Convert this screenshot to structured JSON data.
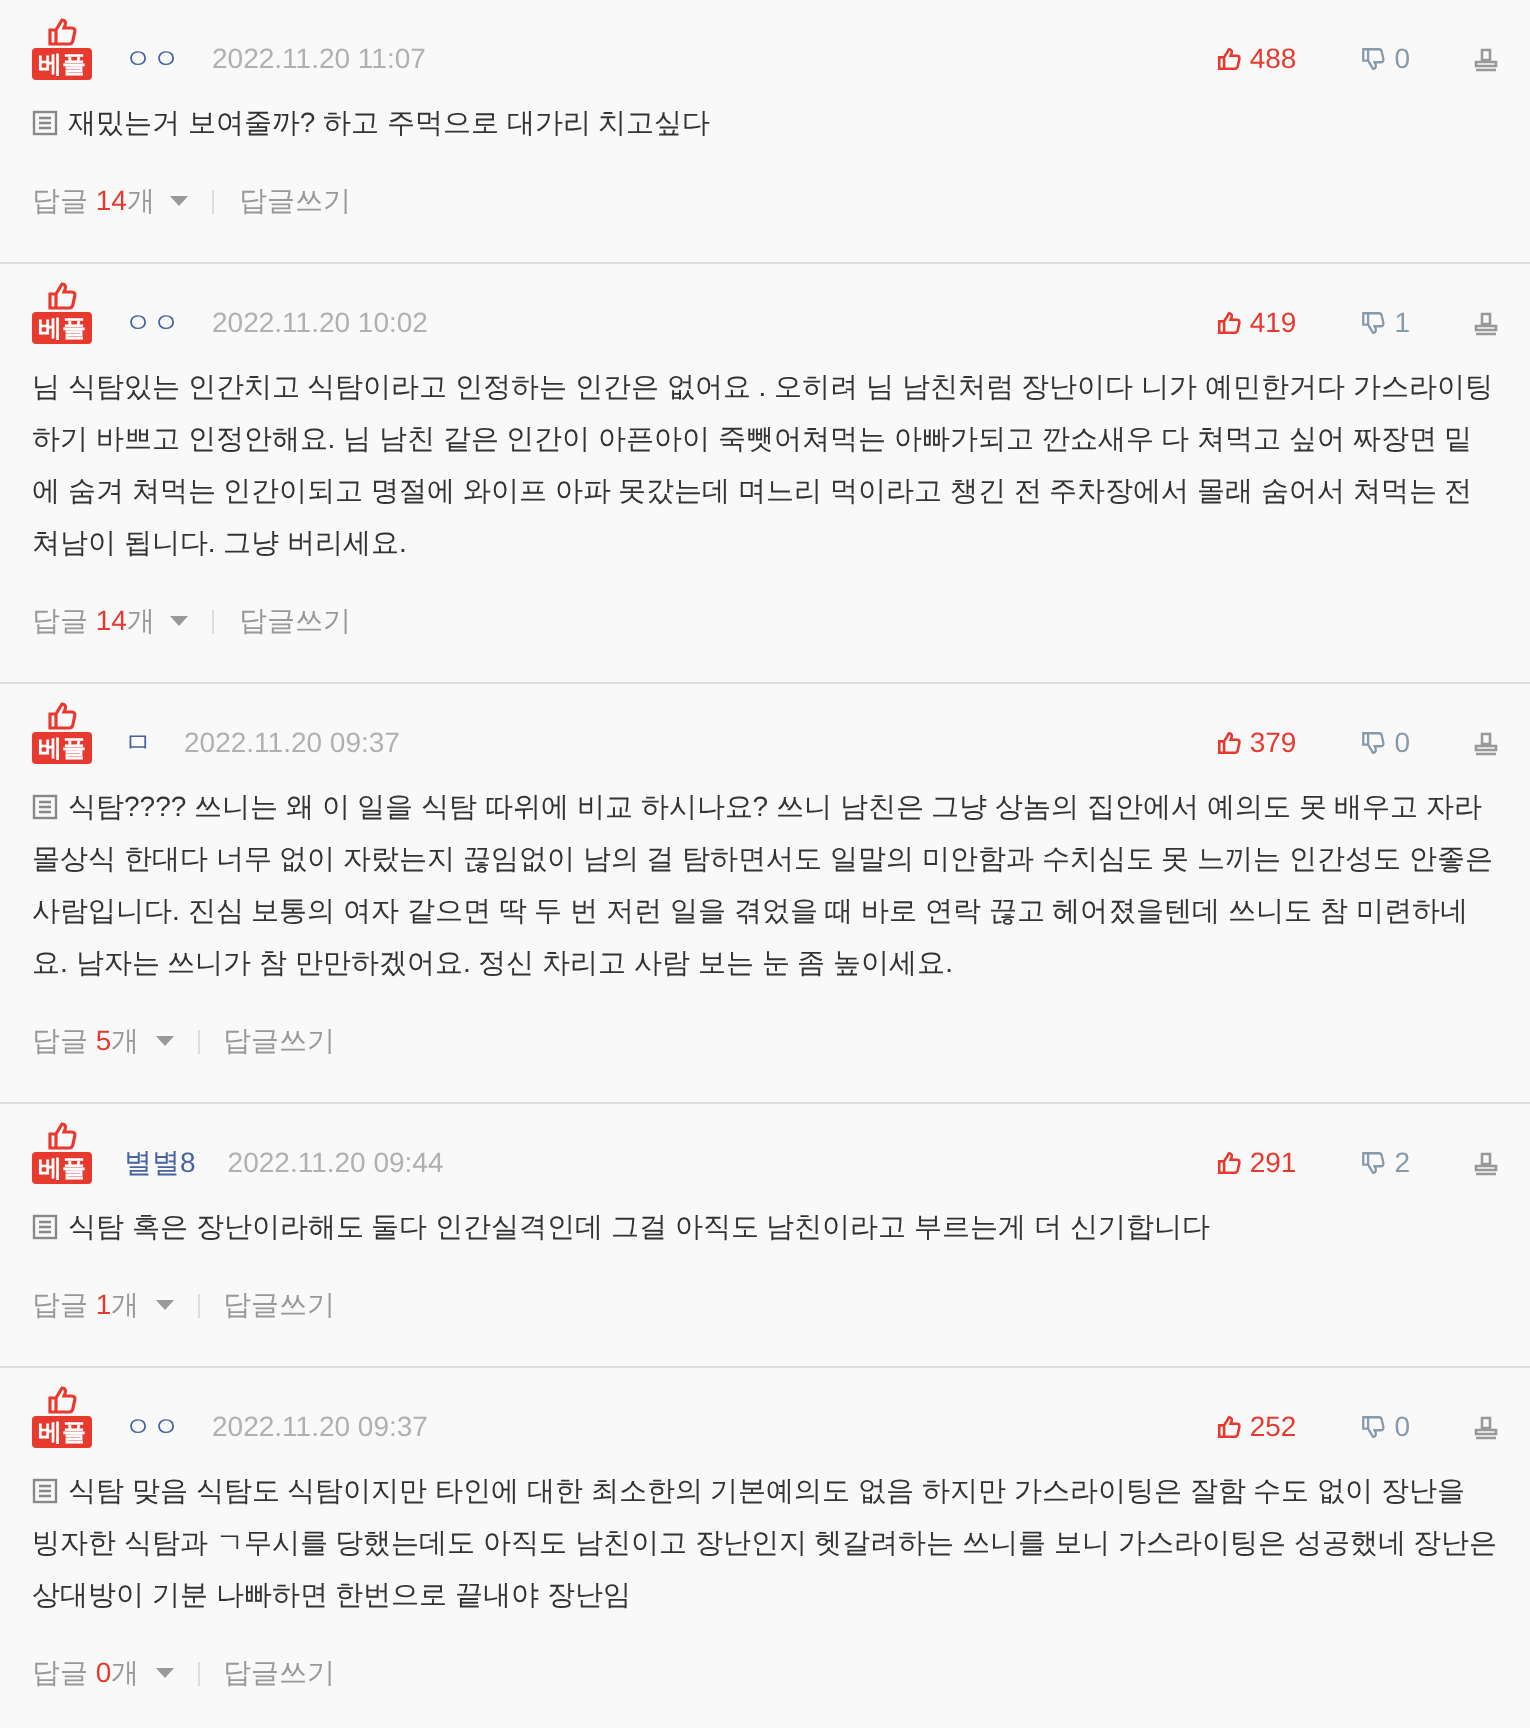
{
  "comments": [
    {
      "badge": "베플",
      "author": "ㅇㅇ",
      "date": "2022.11.20 11:07",
      "likes": "488",
      "dislikes": "0",
      "note_icon": true,
      "text": "재밌는거 보여줄까? 하고 주먹으로 대가리 치고싶다",
      "reply_prefix": "답글",
      "reply_count": "14",
      "reply_suffix": "개",
      "write_reply": "답글쓰기"
    },
    {
      "badge": "베플",
      "author": "ㅇㅇ",
      "date": "2022.11.20 10:02",
      "likes": "419",
      "dislikes": "1",
      "note_icon": false,
      "text": "님 식탐있는 인간치고 식탐이라고 인정하는 인간은 없어요 . 오히려 님 남친처럼 장난이다 니가 예민한거다 가스라이팅하기 바쁘고 인정안해요. 님 남친 같은 인간이 아픈아이 죽뺏어쳐먹는 아빠가되고 깐쇼새우 다 쳐먹고 싶어 짜장면 밑에 숨겨 쳐먹는 인간이되고 명절에 와이프 아파 못갔는데 며느리 먹이라고 챙긴 전 주차장에서 몰래 숨어서 쳐먹는 전쳐남이 됩니다. 그냥 버리세요.",
      "reply_prefix": "답글",
      "reply_count": "14",
      "reply_suffix": "개",
      "write_reply": "답글쓰기"
    },
    {
      "badge": "베플",
      "author": "ㅁ",
      "date": "2022.11.20 09:37",
      "likes": "379",
      "dislikes": "0",
      "note_icon": true,
      "text": "식탐???? 쓰니는 왜 이 일을 식탐 따위에 비교 하시나요? 쓰니 남친은 그냥 상놈의 집안에서 예의도 못 배우고 자라 몰상식 한대다 너무 없이 자랐는지 끊임없이 남의 걸 탐하면서도 일말의 미안함과 수치심도 못 느끼는 인간성도 안좋은 사람입니다. 진심 보통의 여자 같으면 딱 두 번 저런 일을 겪었을 때 바로 연락 끊고 헤어졌을텐데 쓰니도 참 미련하네요. 남자는 쓰니가 참 만만하겠어요. 정신 차리고 사람 보는 눈 좀 높이세요.",
      "reply_prefix": "답글",
      "reply_count": "5",
      "reply_suffix": "개",
      "write_reply": "답글쓰기"
    },
    {
      "badge": "베플",
      "author": "별별8",
      "date": "2022.11.20 09:44",
      "likes": "291",
      "dislikes": "2",
      "note_icon": true,
      "text": "식탐 혹은 장난이라해도 둘다 인간실격인데 그걸 아직도 남친이라고 부르는게 더 신기합니다",
      "reply_prefix": "답글",
      "reply_count": "1",
      "reply_suffix": "개",
      "write_reply": "답글쓰기"
    },
    {
      "badge": "베플",
      "author": "ㅇㅇ",
      "date": "2022.11.20 09:37",
      "likes": "252",
      "dislikes": "0",
      "note_icon": true,
      "text": "식탐 맞음 식탐도 식탐이지만 타인에 대한 최소한의 기본예의도 없음 하지만 가스라이팅은 잘함 수도 없이 장난을 빙자한 식탐과 ㄱ무시를 당했는데도 아직도 남친이고 장난인지 헷갈려하는 쓰니를 보니 가스라이팅은 성공했네 장난은 상대방이 기분 나빠하면 한번으로 끝내야 장난임",
      "reply_prefix": "답글",
      "reply_count": "0",
      "reply_suffix": "개",
      "write_reply": "답글쓰기"
    }
  ]
}
